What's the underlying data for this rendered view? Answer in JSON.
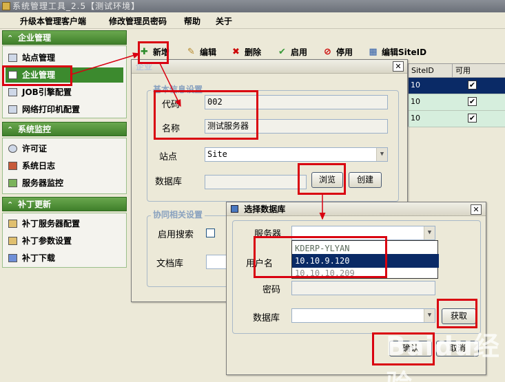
{
  "app": {
    "title": "系统管理工具_2.5【测试环境】"
  },
  "menu": {
    "items": [
      "升级本管理客户端",
      "修改管理员密码",
      "帮助",
      "关于"
    ]
  },
  "sidebar": {
    "sections": [
      {
        "title": "企业管理",
        "items": [
          "站点管理",
          "企业管理",
          "JOB引擎配置",
          "网络打印机配置"
        ]
      },
      {
        "title": "系统监控",
        "items": [
          "许可证",
          "系统日志",
          "服务器监控"
        ]
      },
      {
        "title": "补丁更新",
        "items": [
          "补丁服务器配置",
          "补丁参数设置",
          "补丁下载"
        ]
      }
    ],
    "selected": "企业管理"
  },
  "toolbar": {
    "new": "新增",
    "edit": "编辑",
    "delete": "删除",
    "enable": "启用",
    "disable": "停用",
    "edit_siteid": "编辑SiteID"
  },
  "grid": {
    "columns": [
      "SiteID",
      "可用"
    ],
    "rows": [
      {
        "siteid": "10",
        "enabled": true
      },
      {
        "siteid": "10",
        "enabled": true
      },
      {
        "siteid": "10",
        "enabled": true
      }
    ]
  },
  "enterprise_dialog": {
    "title": "企业",
    "basic_legend": "基本信息设置",
    "code_label": "代码",
    "code_value": "002",
    "name_label": "名称",
    "name_value": "测试服务器",
    "site_label": "站点",
    "site_value": "Site",
    "database_label": "数据库",
    "browse_button": "浏览",
    "create_button": "创建",
    "collab_legend": "协同相关设置",
    "enable_search_label": "启用搜索",
    "doc_lib_label": "文档库"
  },
  "select_db_dialog": {
    "title": "选择数据库",
    "server_label": "服务器",
    "username_label": "用户名",
    "password_label": "密码",
    "database_label": "数据库",
    "fetch_button": "获取",
    "ok_button": "确认",
    "cancel_button": "取消",
    "server_options": [
      "KDERP-YLYAN",
      "10.10.9.120",
      "10.10.10.209"
    ],
    "selected_option": "10.10.9.120"
  },
  "watermark": "Baidu经验",
  "colors": {
    "highlight": "#d90010",
    "accent_green": "#3f7f2a",
    "selection": "#0a2a66"
  }
}
